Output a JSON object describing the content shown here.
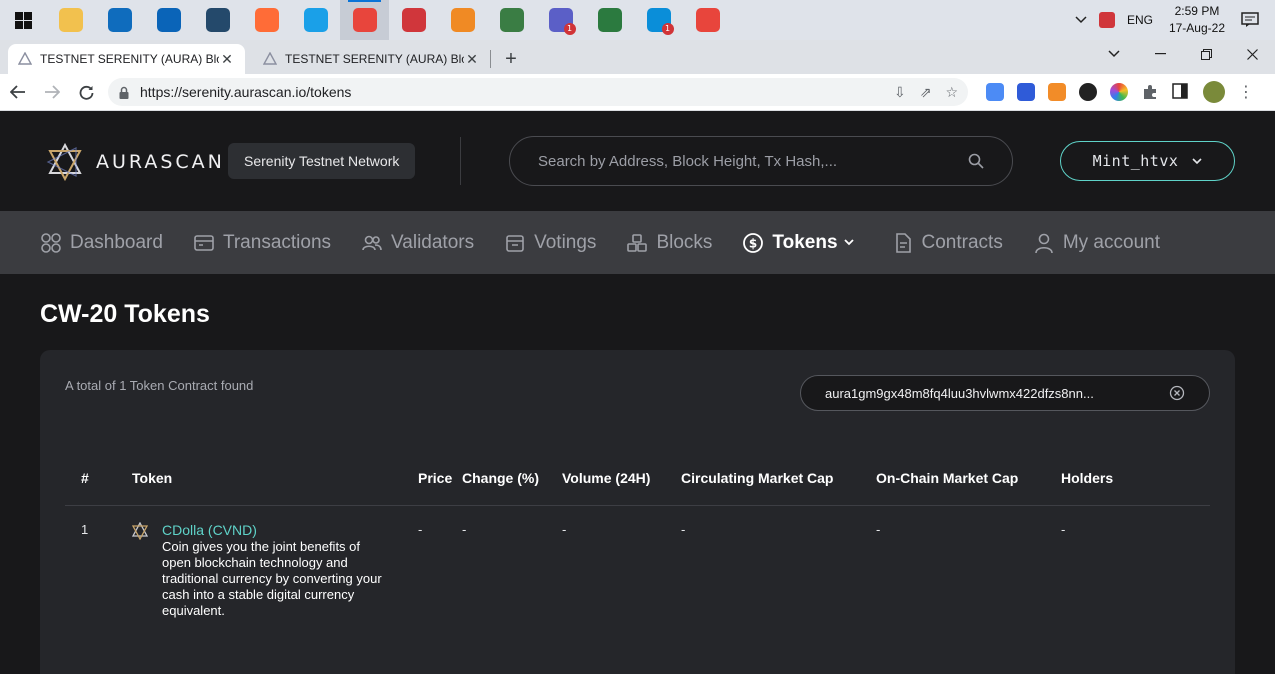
{
  "taskbar": {
    "apps": [
      {
        "icon": "file-explorer-icon",
        "color": "#f2c14e"
      },
      {
        "icon": "mail-icon",
        "color": "#0f6cbd"
      },
      {
        "icon": "outlook-icon",
        "color": "#0a64b8"
      },
      {
        "icon": "sql-tool-icon",
        "color": "#24496b"
      },
      {
        "icon": "postman-icon",
        "color": "#ff6c37"
      },
      {
        "icon": "edge-icon",
        "color": "#1aa0e8"
      },
      {
        "icon": "chrome-icon",
        "color": "#e8453c"
      },
      {
        "icon": "presentation-icon",
        "color": "#d0363b"
      },
      {
        "icon": "vpn-icon",
        "color": "#f08a24"
      },
      {
        "icon": "git-icon",
        "color": "#3a7d44"
      },
      {
        "icon": "teams-icon",
        "color": "#5b5fc7",
        "badge": "1"
      },
      {
        "icon": "paint-icon",
        "color": "#2b7a3f"
      },
      {
        "icon": "skype-icon",
        "color": "#0a8ed9",
        "badge": "1"
      },
      {
        "icon": "chrome-profile-icon",
        "color": "#e8453c"
      }
    ],
    "language": "ENG",
    "time": "2:59 PM",
    "date": "17-Aug-22"
  },
  "browser": {
    "tabs": [
      {
        "title": "TESTNET SERENITY (AURA) Block",
        "active": true
      },
      {
        "title": "TESTNET SERENITY (AURA) Block",
        "active": false
      }
    ],
    "url": "https://serenity.aurascan.io/tokens"
  },
  "site": {
    "logo_text": "AURASCAN",
    "network": "Serenity Testnet Network",
    "search_placeholder": "Search by Address, Block Height, Tx Hash,...",
    "wallet": "Mint_htvx",
    "nav": [
      {
        "label": "Dashboard",
        "icon": "dashboard-icon"
      },
      {
        "label": "Transactions",
        "icon": "transactions-icon"
      },
      {
        "label": "Validators",
        "icon": "validators-icon"
      },
      {
        "label": "Votings",
        "icon": "votings-icon"
      },
      {
        "label": "Blocks",
        "icon": "blocks-icon"
      },
      {
        "label": "Tokens",
        "icon": "tokens-icon",
        "active": true
      },
      {
        "label": "Contracts",
        "icon": "contracts-icon"
      },
      {
        "label": "My account",
        "icon": "account-icon"
      }
    ]
  },
  "page": {
    "title": "CW-20 Tokens",
    "total_text": "A total of 1 Token Contract found",
    "filter_value": "aura1gm9gx48m8fq4luu3hvlwmx422dfzs8nn...",
    "table": {
      "headers": [
        "#",
        "Token",
        "Price",
        "Change (%)",
        "Volume (24H)",
        "Circulating Market Cap",
        "On-Chain Market Cap",
        "Holders"
      ],
      "rows": [
        {
          "index": "1",
          "name": "CDolla (CVND)",
          "description": "Coin gives you the joint benefits of open blockchain technology and traditional currency by converting your cash into a stable digital currency equivalent.",
          "price": "-",
          "change": "-",
          "volume": "-",
          "circulating_cap": "-",
          "onchain_cap": "-",
          "holders": "-"
        }
      ]
    }
  },
  "colors": {
    "accent": "#5fd3c9",
    "background": "#18181a",
    "card": "#25262a",
    "nav": "#3b3c40"
  }
}
